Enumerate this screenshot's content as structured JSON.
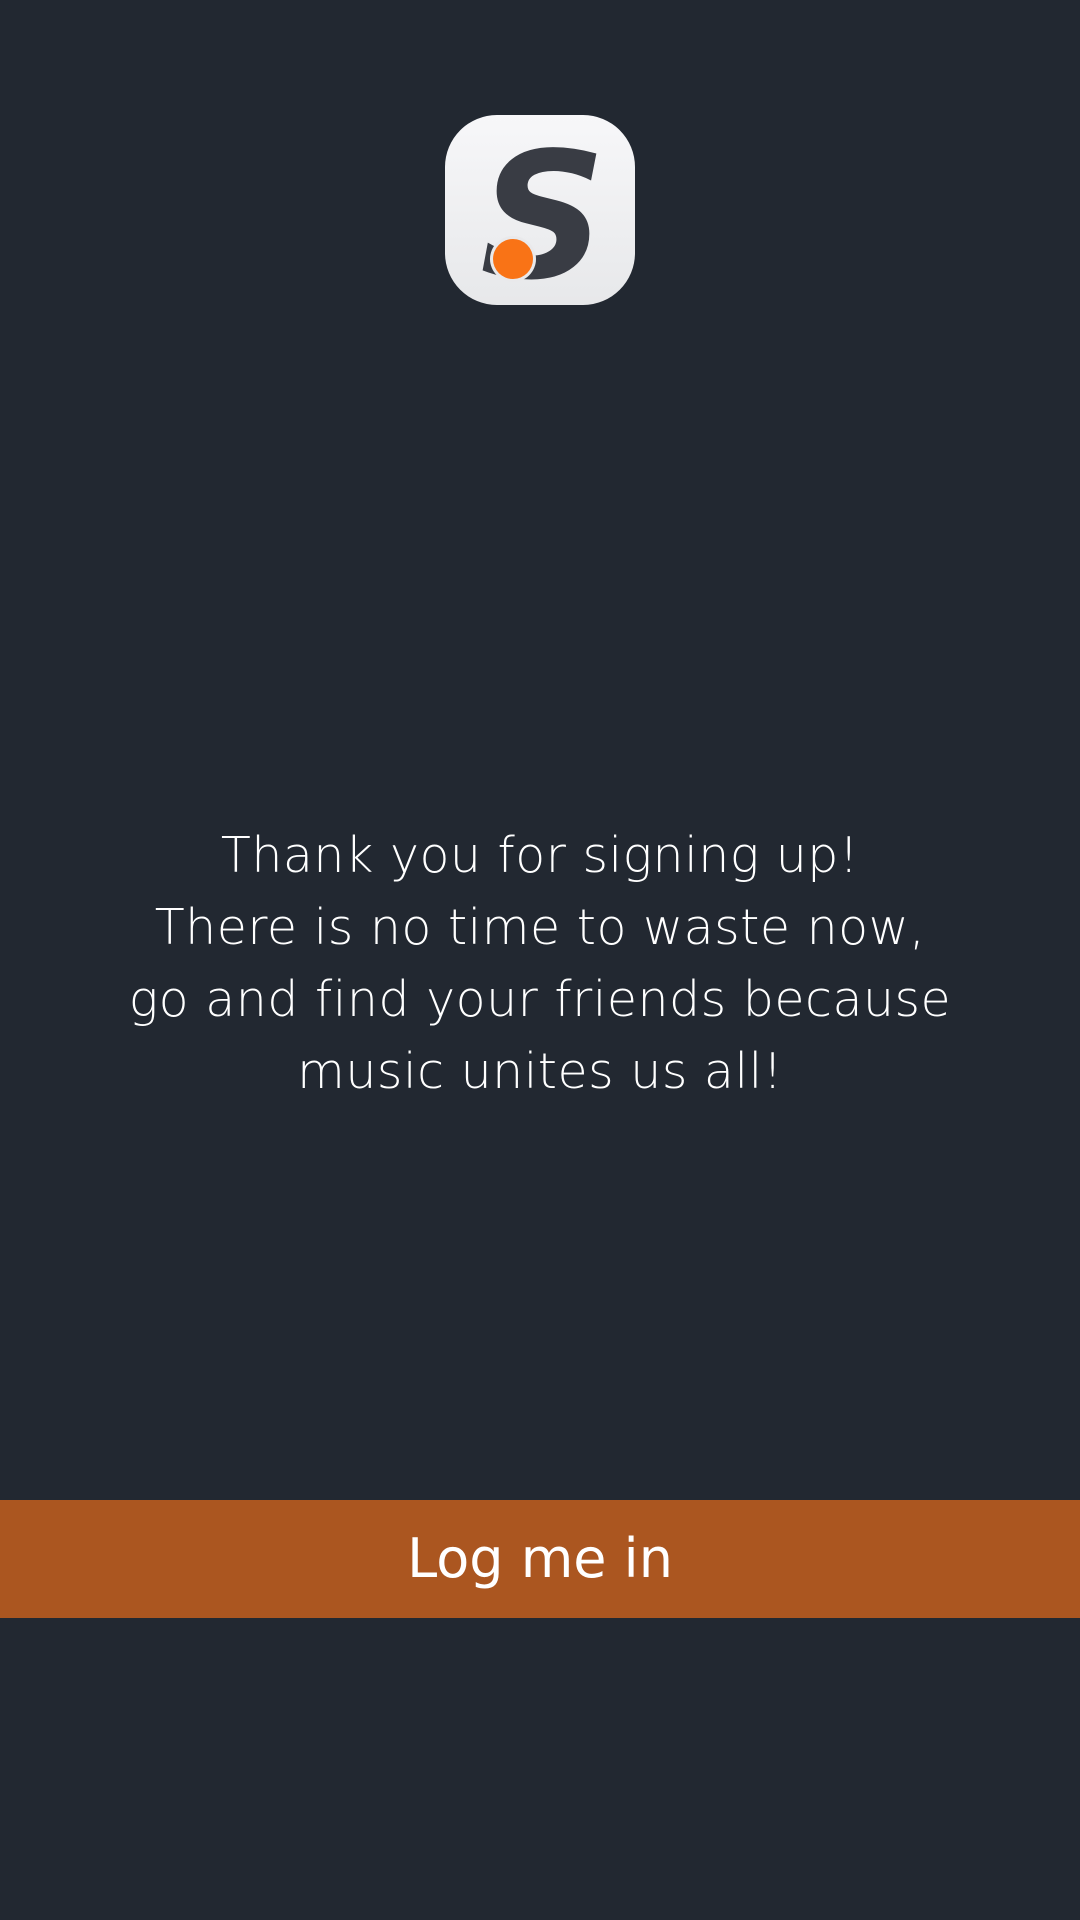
{
  "logo": {
    "icon": "app-logo-s-icon",
    "letter": "S",
    "letter_color": "#393c44",
    "dot_color": "#f97316",
    "background_color": "#f2f2f4"
  },
  "message": {
    "lines": [
      "Thank you for signing up!",
      "There is no time to waste now,",
      "go and find your friends because",
      "music unites us all!"
    ]
  },
  "login_button": {
    "label": "Log me in",
    "color": "#ab5620"
  },
  "colors": {
    "background": "#222831",
    "text": "#ffffff"
  }
}
